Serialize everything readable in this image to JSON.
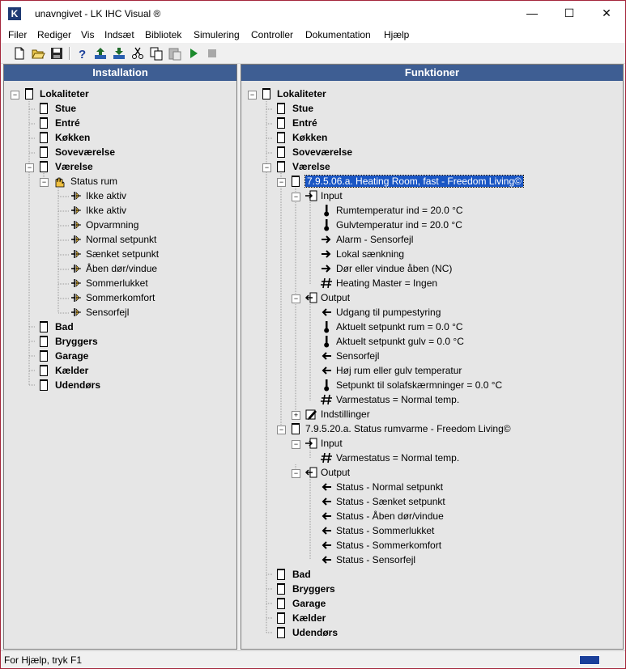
{
  "window": {
    "title": "unavngivet - LK IHC Visual ®",
    "icon": "app-logo-icon"
  },
  "menu": [
    "Filer",
    "Rediger",
    "Vis",
    "Indsæt",
    "Bibliotek",
    "Simulering",
    "Controller",
    "Dokumentation",
    "Hjælp"
  ],
  "toolbar_icons": [
    "new-document-icon",
    "open-folder-icon",
    "save-icon",
    "help-icon",
    "upload-icon",
    "download-icon",
    "cut-icon",
    "copy-icon",
    "paste-icon",
    "play-icon",
    "stop-icon"
  ],
  "left_panel": {
    "header": "Installation",
    "root": "Lokaliteter",
    "rooms_before": [
      "Stue",
      "Entré",
      "Køkken",
      "Soveværelse",
      "Værelse"
    ],
    "status_node": "Status rum",
    "status_children": [
      "Ikke aktiv",
      "Ikke aktiv",
      "Opvarmning",
      "Normal setpunkt",
      "Sænket setpunkt",
      "Åben dør/vindue",
      "Sommerlukket",
      "Sommerkomfort",
      "Sensorfejl"
    ],
    "rooms_after": [
      "Bad",
      "Bryggers",
      "Garage",
      "Kælder",
      "Udendørs"
    ]
  },
  "right_panel": {
    "header": "Funktioner",
    "root": "Lokaliteter",
    "rooms_before": [
      "Stue",
      "Entré",
      "Køkken",
      "Soveværelse",
      "Værelse"
    ],
    "function1": {
      "name": "7.9.5.06.a. Heating Room, fast - Freedom Living©",
      "input_label": "Input",
      "inputs": [
        "Rumtemperatur ind = 20.0 °C",
        "Gulvtemperatur ind = 20.0 °C",
        "Alarm - Sensorfejl",
        "Lokal sænkning",
        "Dør eller vindue åben (NC)",
        "Heating Master = Ingen"
      ],
      "output_label": "Output",
      "outputs": [
        "Udgang til pumpestyring",
        "Aktuelt setpunkt rum = 0.0 °C",
        "Aktuelt setpunkt gulv = 0.0 °C",
        "Sensorfejl",
        "Høj rum eller gulv temperatur",
        "Setpunkt til solafskærmninger = 0.0 °C",
        "Varmestatus = Normal temp."
      ],
      "settings_label": "Indstillinger"
    },
    "function2": {
      "name": "7.9.5.20.a. Status rumvarme - Freedom Living©",
      "input_label": "Input",
      "inputs": [
        "Varmestatus = Normal temp."
      ],
      "output_label": "Output",
      "outputs": [
        "Status - Normal setpunkt",
        "Status - Sænket setpunkt",
        "Status - Åben dør/vindue",
        "Status - Sommerlukket",
        "Status - Sommerkomfort",
        "Status - Sensorfejl"
      ]
    },
    "rooms_after": [
      "Bad",
      "Bryggers",
      "Garage",
      "Kælder",
      "Udendørs"
    ]
  },
  "statusbar": {
    "text": "For Hjælp, tryk F1"
  }
}
